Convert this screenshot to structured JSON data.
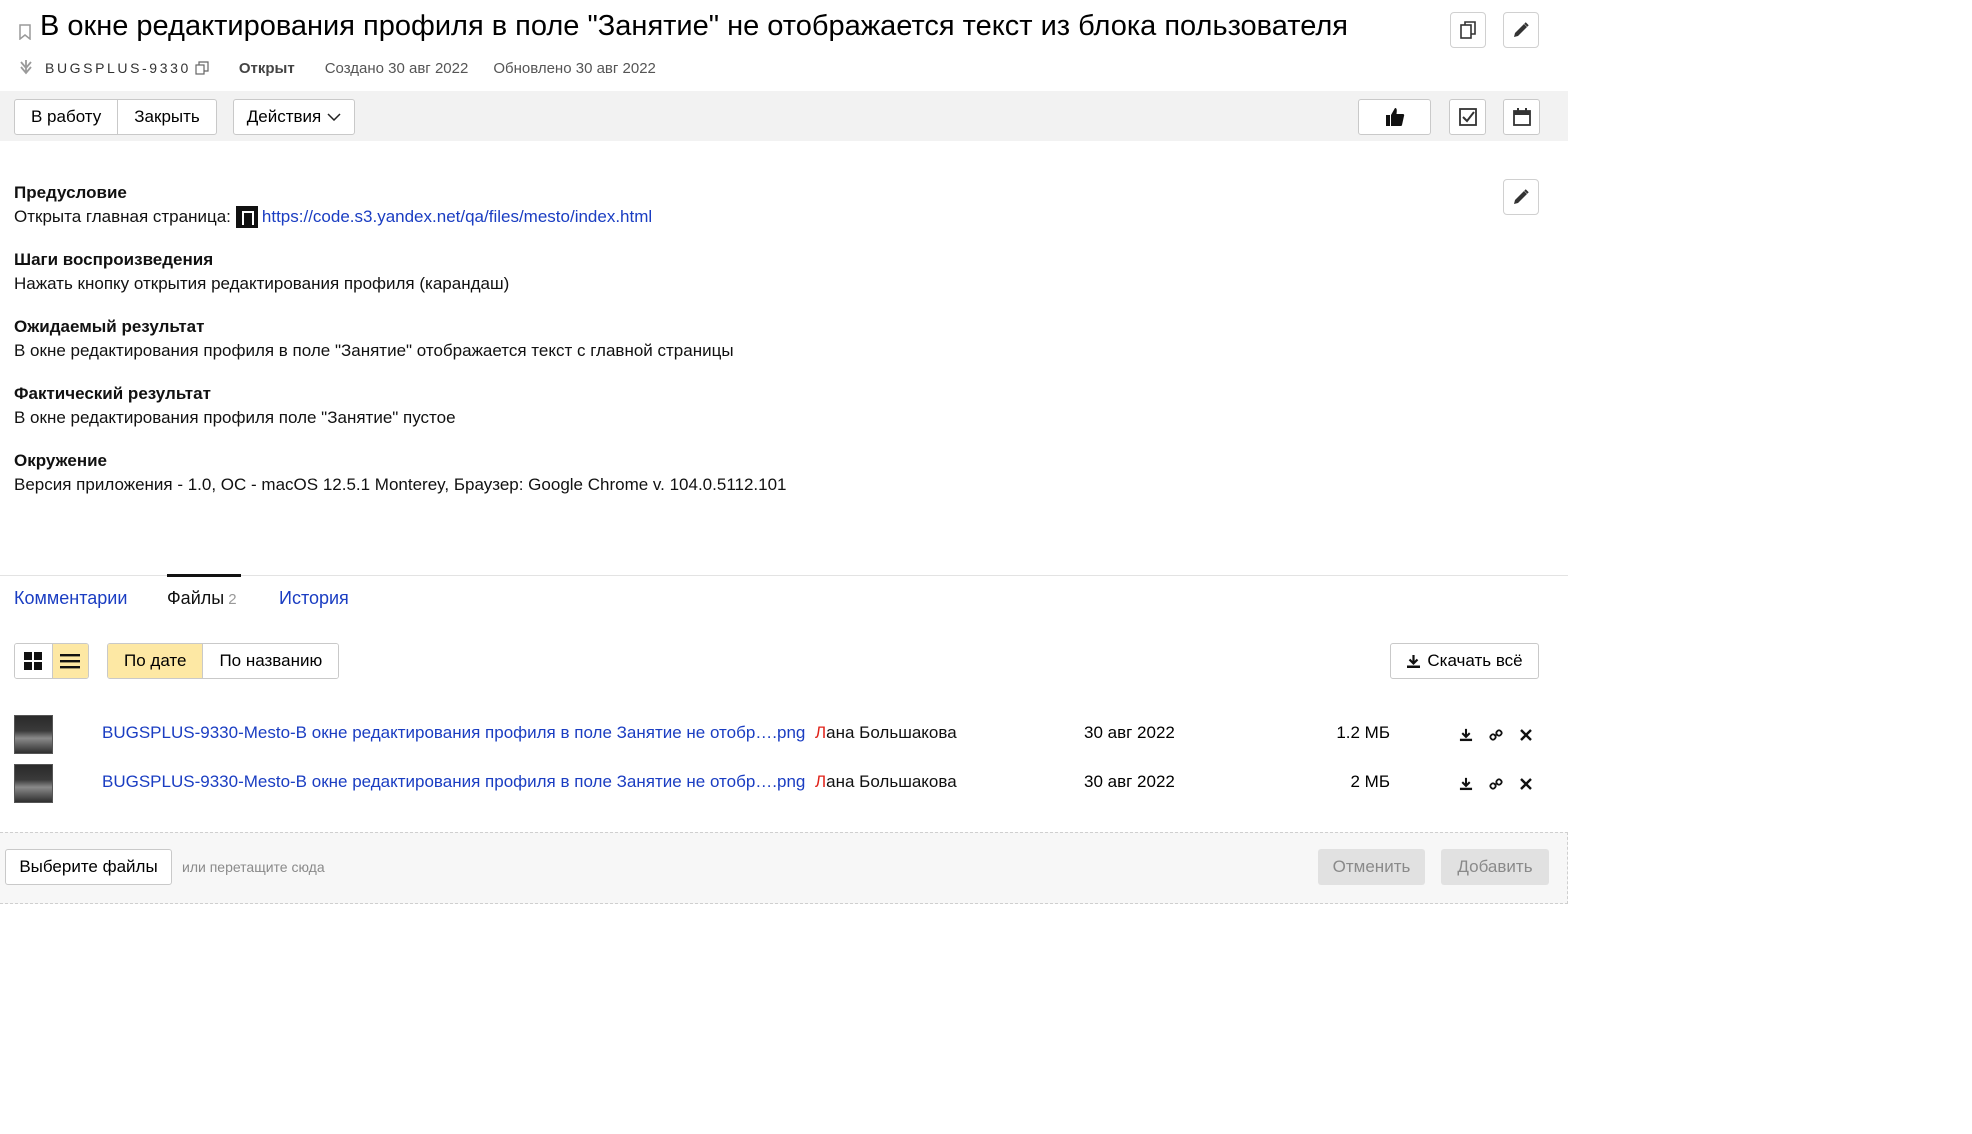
{
  "issue": {
    "title": "В окне редактирования профиля в поле \"Занятие\" не отображается текст из блока пользователя",
    "key": "BUGSPLUS-9330",
    "status": "Открыт",
    "created": "Создано 30 авг 2022",
    "updated": "Обновлено 30 авг 2022"
  },
  "toolbar": {
    "to_work": "В работу",
    "close": "Закрыть",
    "actions": "Действия"
  },
  "description": {
    "precondition_title": "Предусловие",
    "precondition_text": "Открыта главная страница:",
    "precondition_link": "https://code.s3.yandex.net/qa/files/mesto/index.html",
    "steps_title": "Шаги воспроизведения",
    "steps_text": "Нажать кнопку открытия редактирования профиля (карандаш)",
    "expected_title": "Ожидаемый результат",
    "expected_text": "В окне редактирования профиля в поле \"Занятие\" отображается текст с главной страницы",
    "actual_title": "Фактический результат",
    "actual_text": "В окне редактирования профиля поле \"Занятие\" пустое",
    "env_title": "Окружение",
    "env_text": "Версия приложения - 1.0, ОС - macOS 12.5.1 Monterey, Браузер: Google Chrome v. 104.0.5112.101"
  },
  "tabs": {
    "comments": "Комментарии",
    "files": "Файлы",
    "files_count": "2",
    "history": "История"
  },
  "files_controls": {
    "sort_by_date": "По дате",
    "sort_by_name": "По названию",
    "download_all": "Скачать всё"
  },
  "files": [
    {
      "name": "BUGSPLUS-9330-Mesto-В окне редактирования профиля в поле Занятие не отобр….png",
      "author_first": "Л",
      "author_rest": "ана Большакова",
      "date": "30 авг 2022",
      "size": "1.2 МБ"
    },
    {
      "name": "BUGSPLUS-9330-Mesto-В окне редактирования профиля в поле Занятие не отобр….png",
      "author_first": "Л",
      "author_rest": "ана Большакова",
      "date": "30 авг 2022",
      "size": "2 МБ"
    }
  ],
  "upload": {
    "choose": "Выберите файлы",
    "hint": "или перетащите сюда",
    "cancel": "Отменить",
    "add": "Добавить"
  },
  "colors": {
    "link": "#1a3dc2",
    "active_toggle": "#fde8a4",
    "toolbar_bg": "#f2f2f2",
    "author_initial": "#e0231a"
  },
  "icons": [
    "bookmark-icon",
    "issue-type-icon",
    "copy-icon",
    "copy-link-icon",
    "edit-icon",
    "thumbs-up-icon",
    "checklist-icon",
    "calendar-icon",
    "chevron-down-icon",
    "grid-view-icon",
    "list-view-icon",
    "download-icon",
    "link-icon",
    "close-icon"
  ]
}
